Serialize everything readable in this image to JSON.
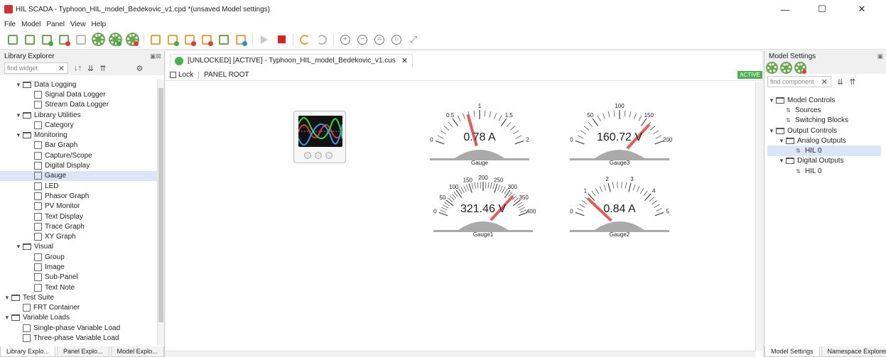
{
  "window": {
    "title": "HIL SCADA - Typhoon_HIL_model_Bedekovic_v1.cpd *(unsaved Model settings)",
    "minimize": "—",
    "maximize": "☐",
    "close": "✕"
  },
  "menu": [
    "File",
    "Model",
    "Panel",
    "View",
    "Help"
  ],
  "library": {
    "title": "Library Explorer",
    "search_placeholder": "find widget",
    "items": [
      {
        "label": "Data Logging",
        "level": 1,
        "folder": true
      },
      {
        "label": "Signal Data Logger",
        "level": 2
      },
      {
        "label": "Stream Data Logger",
        "level": 2
      },
      {
        "label": "Library Utilities",
        "level": 1,
        "folder": true
      },
      {
        "label": "Category",
        "level": 2
      },
      {
        "label": "Monitoring",
        "level": 1,
        "folder": true
      },
      {
        "label": "Bar Graph",
        "level": 2
      },
      {
        "label": "Capture/Scope",
        "level": 2
      },
      {
        "label": "Digital Display",
        "level": 2
      },
      {
        "label": "Gauge",
        "level": 2,
        "selected": true
      },
      {
        "label": "LED",
        "level": 2
      },
      {
        "label": "Phasor Graph",
        "level": 2
      },
      {
        "label": "PV Monitor",
        "level": 2
      },
      {
        "label": "Text Display",
        "level": 2
      },
      {
        "label": "Trace Graph",
        "level": 2
      },
      {
        "label": "XY Graph",
        "level": 2
      },
      {
        "label": "Visual",
        "level": 1,
        "folder": true
      },
      {
        "label": "Group",
        "level": 2
      },
      {
        "label": "Image",
        "level": 2
      },
      {
        "label": "Sub-Panel",
        "level": 2
      },
      {
        "label": "Text Note",
        "level": 2
      },
      {
        "label": "Test Suite",
        "level": 0,
        "folder": true
      },
      {
        "label": "FRT Container",
        "level": 1
      },
      {
        "label": "Variable Loads",
        "level": 0,
        "folder": true
      },
      {
        "label": "Single-phase Variable Load",
        "level": 1
      },
      {
        "label": "Three-phase Variable Load",
        "level": 1
      }
    ],
    "bottom_tabs": [
      "Library Explo...",
      "Panel Explo...",
      "Model Explo..."
    ]
  },
  "editor": {
    "tab_label": "[UNLOCKED] [ACTIVE] - Typhoon_HIL_model_Bedekovic_v1.cus",
    "lock_label": "Lock",
    "root_label": "PANEL ROOT",
    "status": "ACTIVE",
    "gauges": [
      {
        "name": "Gauge",
        "value": 0.78,
        "display": "0.78 A",
        "min": 0,
        "max": 2,
        "ticks": [
          "0",
          "0.5",
          "1",
          "1.5",
          "2"
        ]
      },
      {
        "name": "Gauge3",
        "value": 160.72,
        "display": "160.72 V",
        "min": 0,
        "max": 200,
        "ticks": [
          "0",
          "50",
          "100",
          "150",
          "200"
        ]
      },
      {
        "name": "Gauge1",
        "value": 321.46,
        "display": "321.46 V",
        "min": 0,
        "max": 400,
        "ticks": [
          "0",
          "50",
          "100",
          "150",
          "200",
          "250",
          "300",
          "350",
          "400"
        ]
      },
      {
        "name": "Gauge2",
        "value": 0.84,
        "display": "0.84 A",
        "min": 0,
        "max": 5,
        "ticks": [
          "0",
          "1",
          "2",
          "3",
          "4",
          "5"
        ]
      }
    ]
  },
  "model_settings": {
    "title": "Model Settings",
    "search_placeholder": "find component",
    "items": [
      {
        "label": "Model Controls",
        "level": 0,
        "folder": true
      },
      {
        "label": "Sources",
        "level": 1
      },
      {
        "label": "Switching Blocks",
        "level": 1
      },
      {
        "label": "Output Controls",
        "level": 0,
        "folder": true
      },
      {
        "label": "Analog Outputs",
        "level": 1,
        "folder": true
      },
      {
        "label": "HIL 0",
        "level": 2,
        "selected": true
      },
      {
        "label": "Digital Outputs",
        "level": 1,
        "folder": true
      },
      {
        "label": "HIL 0",
        "level": 2
      }
    ],
    "bottom_tabs": [
      "Model Settings",
      "Namespace Explorer"
    ]
  }
}
